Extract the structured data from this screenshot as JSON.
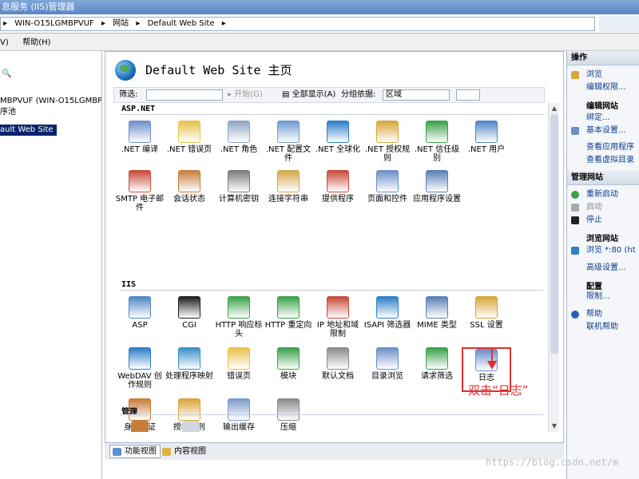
{
  "window": {
    "title": "息服务 (IIS)管理器"
  },
  "address": {
    "segments": [
      "WIN-O15LGMBPVUF",
      "网站",
      "Default Web Site"
    ]
  },
  "menu": {
    "items": [
      "V)",
      "帮助(H)"
    ]
  },
  "tree": {
    "items": [
      "MBPVUF (WIN-O15LGMBPVUF\\Ad",
      "序池",
      "ault Web Site"
    ]
  },
  "page": {
    "title": "Default Web Site 主页"
  },
  "filter": {
    "label": "筛选:",
    "start": "开始(G)",
    "show_all": "全部显示(A)",
    "group_by": "分组依据:",
    "group_value": "区域"
  },
  "groups": {
    "aspnet": "ASP.NET",
    "iis": "IIS",
    "manage": "管理"
  },
  "features": {
    "aspnet": [
      {
        "label": ".NET 编译",
        "icon": "dotnet-compile-icon",
        "color": "#6b8fc9"
      },
      {
        "label": ".NET 错误页",
        "icon": "dotnet-error-pages-icon",
        "color": "#e8c24a"
      },
      {
        "label": ".NET 角色",
        "icon": "dotnet-roles-icon",
        "color": "#8fa7c7"
      },
      {
        "label": ".NET 配置文件",
        "icon": "dotnet-profile-icon",
        "color": "#6f9ad1"
      },
      {
        "label": ".NET 全球化",
        "icon": "dotnet-globalization-icon",
        "color": "#2e7dc7"
      },
      {
        "label": ".NET 授权规则",
        "icon": "dotnet-authorization-icon",
        "color": "#d9a53a"
      },
      {
        "label": ".NET 信任级别",
        "icon": "dotnet-trust-icon",
        "color": "#3aa04a"
      },
      {
        "label": ".NET 用户",
        "icon": "dotnet-users-icon",
        "color": "#4f86c6"
      },
      {
        "label": "SMTP 电子邮件",
        "icon": "smtp-email-icon",
        "color": "#c94a3a"
      },
      {
        "label": "会话状态",
        "icon": "session-state-icon",
        "color": "#c77d3a"
      },
      {
        "label": "计算机密钥",
        "icon": "machine-key-icon",
        "color": "#7a7a7a"
      },
      {
        "label": "连接字符串",
        "icon": "connection-strings-icon",
        "color": "#d4a84a"
      },
      {
        "label": "提供程序",
        "icon": "providers-icon",
        "color": "#c94a3a"
      },
      {
        "label": "页面和控件",
        "icon": "pages-controls-icon",
        "color": "#6b8fc9"
      },
      {
        "label": "应用程序设置",
        "icon": "app-settings-icon",
        "color": "#5a7fb8"
      }
    ],
    "iis": [
      {
        "label": "ASP",
        "icon": "asp-icon",
        "color": "#4f86c6"
      },
      {
        "label": "CGI",
        "icon": "cgi-icon",
        "color": "#1e1e1e"
      },
      {
        "label": "HTTP 响应标头",
        "icon": "http-headers-icon",
        "color": "#3aa04a"
      },
      {
        "label": "HTTP 重定向",
        "icon": "http-redirect-icon",
        "color": "#3aa04a"
      },
      {
        "label": "IP 地址和域限制",
        "icon": "ip-restrictions-icon",
        "color": "#c94a3a"
      },
      {
        "label": "ISAPI 筛选器",
        "icon": "isapi-filters-icon",
        "color": "#2e7dc7"
      },
      {
        "label": "MIME 类型",
        "icon": "mime-types-icon",
        "color": "#5a7fb8"
      },
      {
        "label": "SSL 设置",
        "icon": "ssl-settings-icon",
        "color": "#d9a53a"
      },
      {
        "label": "WebDAV 创作规则",
        "icon": "webdav-icon",
        "color": "#2e7dc7"
      },
      {
        "label": "处理程序映射",
        "icon": "handler-mappings-icon",
        "color": "#3a8fc9"
      },
      {
        "label": "错误页",
        "icon": "error-pages-icon",
        "color": "#e8c24a"
      },
      {
        "label": "模块",
        "icon": "modules-icon",
        "color": "#3aa04a"
      },
      {
        "label": "默认文档",
        "icon": "default-document-icon",
        "color": "#8a8a8a"
      },
      {
        "label": "目录浏览",
        "icon": "directory-browsing-icon",
        "color": "#6b8fc9"
      },
      {
        "label": "请求筛选",
        "icon": "request-filtering-icon",
        "color": "#3aa04a"
      },
      {
        "label": "日志",
        "icon": "logging-icon",
        "color": "#6b8fc9"
      },
      {
        "label": "身份验证",
        "icon": "authentication-icon",
        "color": "#c77d3a"
      },
      {
        "label": "授权规则",
        "icon": "authorization-rules-icon",
        "color": "#d9a53a"
      },
      {
        "label": "输出缓存",
        "icon": "output-caching-icon",
        "color": "#7a9ac9"
      },
      {
        "label": "压缩",
        "icon": "compression-icon",
        "color": "#8a8a8a"
      }
    ]
  },
  "bottom_tabs": {
    "features": "功能视图",
    "content": "内容视图"
  },
  "actions": {
    "header_actions": "操作",
    "browse": "浏览",
    "edit_permissions": "编辑权限...",
    "edit_site": "编辑网站",
    "bindings": "绑定...",
    "basic_settings": "基本设置...",
    "view_apps": "查看应用程序",
    "view_vdirs": "查看虚拟目录",
    "header_manage": "管理网站",
    "restart": "重新启动",
    "start": "启动",
    "stop": "停止",
    "browse_site": "浏览网站",
    "browse_port": "浏览 *:80 (ht",
    "advanced": "高级设置...",
    "configure": "配置",
    "limits": "限制...",
    "help": "帮助",
    "online_help": "联机帮助"
  },
  "annotation": {
    "text": "双击“日志”"
  },
  "watermark": {
    "text": "https://blog.csdn.net/m"
  }
}
